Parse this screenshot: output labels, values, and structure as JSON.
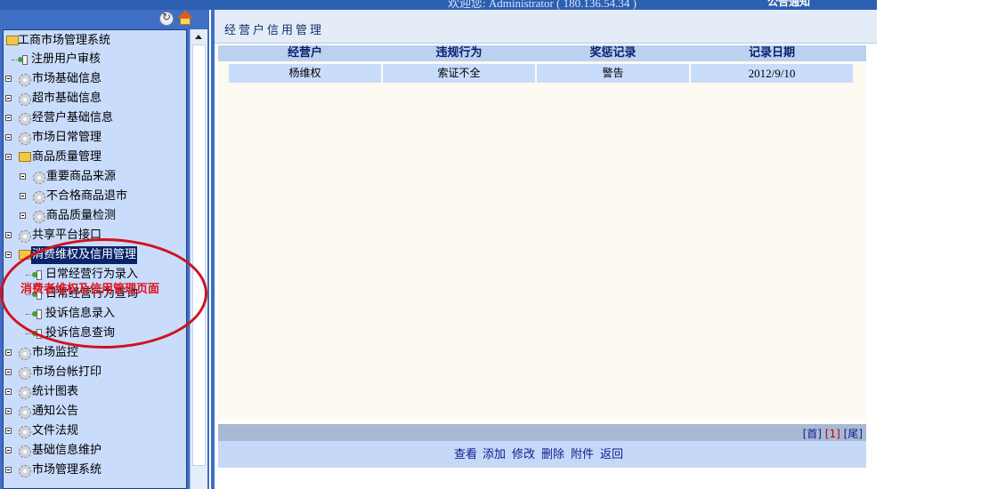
{
  "header": {
    "welcome": "欢迎您: Administrator ( 180.136.54.34 )",
    "notice": "公告通知"
  },
  "sidebar": {
    "root": "工商市场管理系统",
    "items": [
      {
        "label": "注册用户审核"
      },
      {
        "label": "市场基础信息"
      },
      {
        "label": "超市基础信息"
      },
      {
        "label": "经营户基础信息"
      },
      {
        "label": "市场日常管理"
      },
      {
        "label": "商品质量管理"
      },
      {
        "label": "重要商品来源"
      },
      {
        "label": "不合格商品退市"
      },
      {
        "label": "商品质量检测"
      },
      {
        "label": "共享平台接口"
      },
      {
        "label": "消费维权及信用管理"
      },
      {
        "label": "日常经营行为录入"
      },
      {
        "label": "日常经营行为查询"
      },
      {
        "label": "投诉信息录入"
      },
      {
        "label": "投诉信息查询"
      },
      {
        "label": "市场监控"
      },
      {
        "label": "市场台帐打印"
      },
      {
        "label": "统计图表"
      },
      {
        "label": "通知公告"
      },
      {
        "label": "文件法规"
      },
      {
        "label": "基础信息维护"
      },
      {
        "label": "市场管理系统"
      }
    ]
  },
  "main": {
    "title": "经营户信用管理",
    "table": {
      "headers": [
        "经营户",
        "违规行为",
        "奖惩记录",
        "记录日期"
      ],
      "rows": [
        [
          "杨维权",
          "索证不全",
          "警告",
          "2012/9/10"
        ]
      ]
    },
    "pager": {
      "first": "[首]",
      "current": "[1]",
      "last": "[尾]"
    },
    "actions": [
      "查看",
      "添加",
      "修改",
      "删除",
      "附件",
      "返回"
    ]
  },
  "annotation": {
    "text": "消费者维权及信用管理页面",
    "color": "#d0121d"
  }
}
